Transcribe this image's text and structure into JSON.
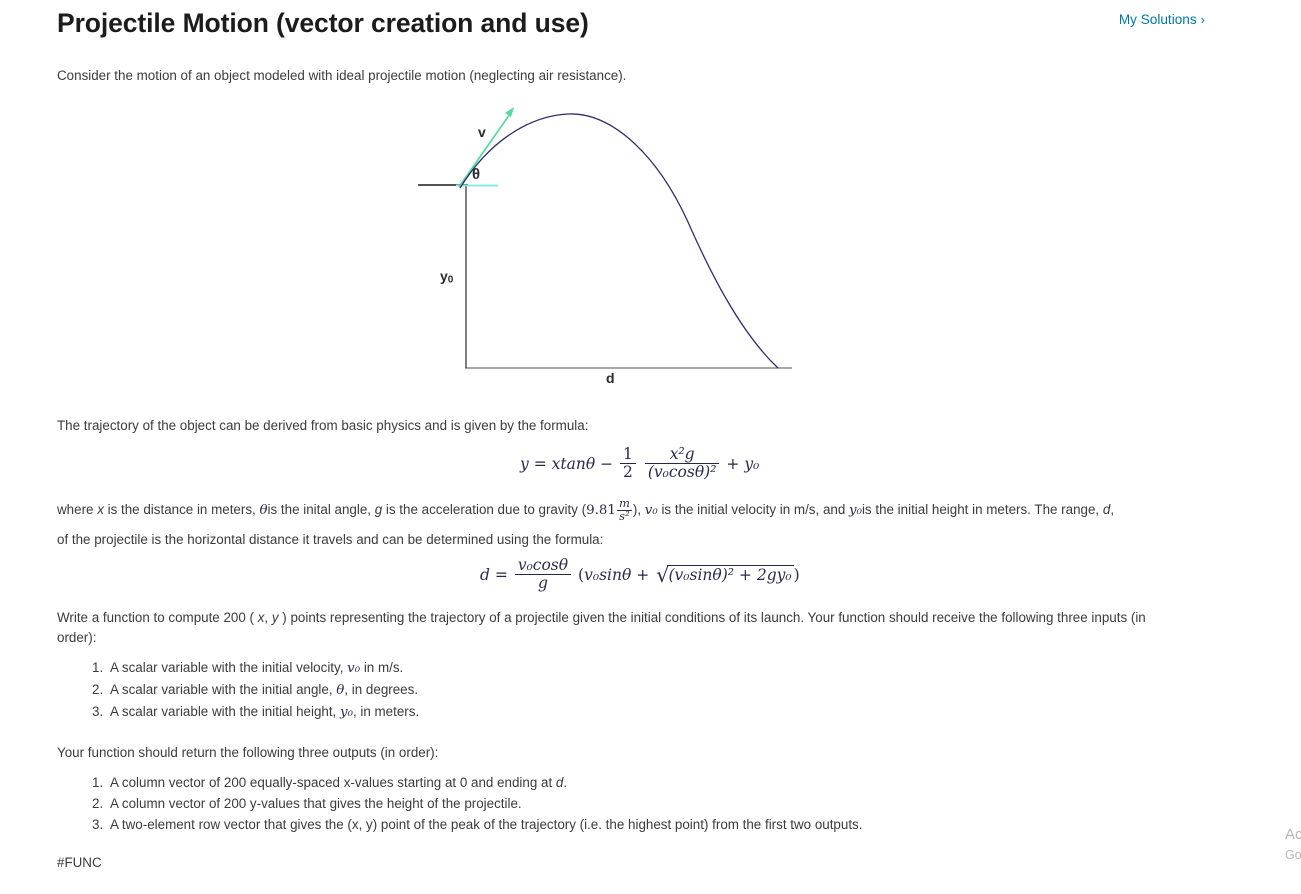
{
  "header": {
    "title": "Projectile Motion (vector creation and use)",
    "my_solutions_label": "My Solutions",
    "my_solutions_chevron": "chevron-right-icon",
    "link_color": "#0076a8"
  },
  "intro": "Consider the motion of an object modeled with ideal projectile motion (neglecting air resistance).",
  "diagram": {
    "labels": {
      "velocity": "v",
      "angle": "θ",
      "initial_height": "y",
      "initial_height_sub": "0",
      "range": "d"
    },
    "colors": {
      "trajectory": "#2e2e6e",
      "vector": "#55d9a0",
      "horizontal_ref": "#7fe8e0",
      "axis": "#8a8a8a",
      "tick": "#1c1c1c"
    }
  },
  "trajectory_intro": "The trajectory of the object can be derived from basic physics and is given by the formula:",
  "equation_y": {
    "lhs": "y",
    "eq": "=",
    "term1": "xtanθ",
    "minus": "−",
    "half_num": "1",
    "half_den": "2",
    "frac_num": "x²g",
    "frac_den": "(v₀cosθ)²",
    "plus": "+",
    "term_last": "y₀"
  },
  "where_paragraph": {
    "p1": "where ",
    "x": "x",
    "p2": " is the distance in meters, ",
    "theta": "θ",
    "p3": "is the inital angle, ",
    "g": "g",
    "p4": " is the acceleration due to gravity (",
    "gravity_value": "9.81",
    "gravity_unit_num": "m",
    "gravity_unit_den": "s²",
    "p5": "), ",
    "v0": "v₀",
    "p6": " is the initial velocity in m/s, and ",
    "y0": "y₀",
    "p7": "is the initial height in meters. The range, ",
    "d": "d",
    "p8": ","
  },
  "range_paragraph": "of the projectile is the horizontal distance it travels and can be determined using the formula:",
  "equation_d": {
    "lhs": "d",
    "eq": "=",
    "frac_num": "v₀cosθ",
    "frac_den": "g",
    "open_paren": "(",
    "term1": "v₀sinθ",
    "plus": "+",
    "radical": "√",
    "radicand": "(v₀sinθ)² + 2gy₀",
    "close_paren": ")"
  },
  "write_paragraph": {
    "p1": "Write a function to compute 200 ( ",
    "x": "x",
    "p2": ", ",
    "y": "y",
    "p3": " ) points representing the trajectory of a projectile given the initial conditions of its launch. Your function should receive the following three inputs (in order):"
  },
  "inputs_list": [
    {
      "num": "1.",
      "p1": "A scalar variable with the initial velocity, ",
      "sym": "v₀",
      "p2": " in m/s."
    },
    {
      "num": "2.",
      "p1": "A scalar variable with the initial angle, ",
      "sym": "θ",
      "p2": ", in degrees."
    },
    {
      "num": "3.",
      "p1": "A scalar variable with the initial height, ",
      "sym": "y₀",
      "p2": ", in meters."
    }
  ],
  "outputs_intro": "Your function should return the following three outputs (in order):",
  "outputs_list": [
    {
      "num": "1.",
      "p1": "A column vector of 200 equally-spaced x-values starting at 0 and ending at ",
      "sym": "d",
      "p2": "."
    },
    {
      "num": "2.",
      "p1": "A column vector of 200 y-values that gives the height of the projectile.",
      "sym": "",
      "p2": ""
    },
    {
      "num": "3.",
      "p1": "A two-element row vector that gives the (x, y) point of the peak of the trajectory (i.e. the highest point) from the first two outputs.",
      "sym": "",
      "p2": ""
    }
  ],
  "func_tag": "#FUNC",
  "watermark": {
    "line1": "Activate Windows",
    "line2": "Go to Settings to activate Windows."
  }
}
